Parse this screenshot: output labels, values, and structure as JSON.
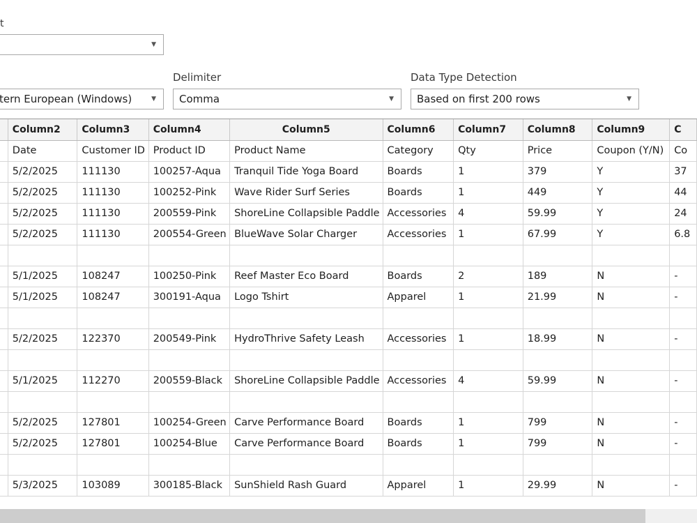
{
  "top_label_fragment": "t",
  "controls": {
    "file_origin": {
      "value": ""
    },
    "encoding": {
      "value": "tern European (Windows)"
    },
    "delimiter": {
      "label": "Delimiter",
      "value": "Comma"
    },
    "detection": {
      "label": "Data Type Detection",
      "value": "Based on first 200 rows"
    }
  },
  "grid": {
    "headers": [
      "",
      "Column2",
      "Column3",
      "Column4",
      "Column5",
      "Column6",
      "Column7",
      "Column8",
      "Column9",
      "C"
    ],
    "rows": [
      [
        "",
        "Date",
        "Customer ID",
        "Product ID",
        "Product Name",
        "Category",
        "Qty",
        "Price",
        "Coupon (Y/N)",
        "Co"
      ],
      [
        "",
        "5/2/2025",
        "111130",
        "100257-Aqua",
        "Tranquil Tide Yoga Board",
        "Boards",
        "1",
        "379",
        "Y",
        "37"
      ],
      [
        "",
        "5/2/2025",
        "111130",
        "100252-Pink",
        "Wave Rider Surf Series",
        "Boards",
        "1",
        "449",
        "Y",
        "44"
      ],
      [
        "",
        "5/2/2025",
        "111130",
        "200559-Pink",
        "ShoreLine Collapsible Paddle",
        "Accessories",
        "4",
        "59.99",
        "Y",
        "24"
      ],
      [
        "",
        "5/2/2025",
        "111130",
        "200554-Green",
        "BlueWave Solar Charger",
        "Accessories",
        "1",
        "67.99",
        "Y",
        "6.8"
      ],
      [
        "",
        "",
        "",
        "",
        "",
        "",
        "",
        "",
        "",
        ""
      ],
      [
        "",
        "5/1/2025",
        "108247",
        "100250-Pink",
        "Reef Master Eco Board",
        "Boards",
        "2",
        "189",
        "N",
        "-"
      ],
      [
        "",
        "5/1/2025",
        "108247",
        "300191-Aqua",
        "Logo Tshirt",
        "Apparel",
        "1",
        "21.99",
        "N",
        "-"
      ],
      [
        "",
        "",
        "",
        "",
        "",
        "",
        "",
        "",
        "",
        ""
      ],
      [
        "",
        "5/2/2025",
        "122370",
        "200549-Pink",
        "HydroThrive Safety Leash",
        "Accessories",
        "1",
        "18.99",
        "N",
        "-"
      ],
      [
        "",
        "",
        "",
        "",
        "",
        "",
        "",
        "",
        "",
        ""
      ],
      [
        "",
        "5/1/2025",
        "112270",
        "200559-Black",
        "ShoreLine Collapsible Paddle",
        "Accessories",
        "4",
        "59.99",
        "N",
        "-"
      ],
      [
        "",
        "",
        "",
        "",
        "",
        "",
        "",
        "",
        "",
        ""
      ],
      [
        "",
        "5/2/2025",
        "127801",
        "100254-Green",
        "Carve Performance Board",
        "Boards",
        "1",
        "799",
        "N",
        "-"
      ],
      [
        "",
        "5/2/2025",
        "127801",
        "100254-Blue",
        "Carve Performance Board",
        "Boards",
        "1",
        "799",
        "N",
        "-"
      ],
      [
        "",
        "",
        "",
        "",
        "",
        "",
        "",
        "",
        "",
        ""
      ],
      [
        "",
        "5/3/2025",
        "103089",
        "300185-Black",
        "SunShield Rash Guard",
        "Apparel",
        "1",
        "29.99",
        "N",
        "-"
      ]
    ]
  },
  "colors": {
    "header_bg": "#f3f3f3",
    "grid_line": "#d6d6d6",
    "border": "#a9a9a9"
  }
}
